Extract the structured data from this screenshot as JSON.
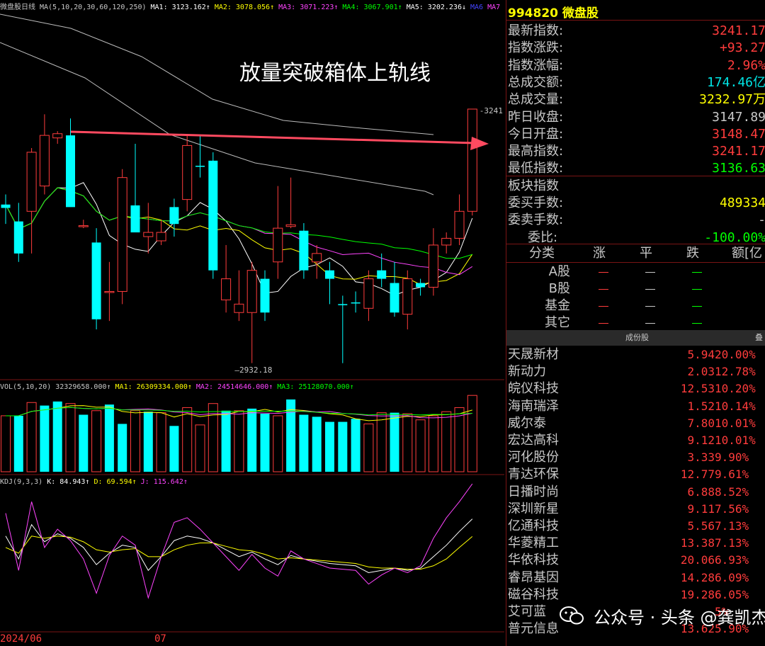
{
  "kline_header": {
    "title": "微盘股日线",
    "params": "MA(5,10,20,30,60,120,250)",
    "ma1": "MA1: 3123.162↑",
    "ma2": "MA2: 3078.056↑",
    "ma3": "MA3: 3071.223↑",
    "ma4": "MA4: 3067.901↑",
    "ma5": "MA5: 3202.236↓",
    "ma6": "MA6",
    "ma7": "MA7",
    "colors": {
      "ma1": "#ffffff",
      "ma2": "#ffff00",
      "ma3": "#ff00ff",
      "ma4": "#00ff00",
      "ma5": "#ffffff"
    }
  },
  "annotation": "放量突破箱体上轨线",
  "price_labels": {
    "high": "3241.17",
    "low": "2932.18"
  },
  "vol_header": {
    "title": "VOL(5,10,20)",
    "value": "32329658.000↑",
    "ma1": "MA1: 26309334.000↑",
    "ma2": "MA2: 24514646.000↑",
    "ma3": "MA3: 25128070.000↑"
  },
  "kdj_header": {
    "title": "KDJ(9,3,3)",
    "k": "K: 84.943↑",
    "d": "D: 69.594↑",
    "j": "J: 115.642↑"
  },
  "dates": {
    "left": "2024/06",
    "mid": "07"
  },
  "chart_data": {
    "type": "candlestick",
    "candles": [
      {
        "o": 3124,
        "h": 3140,
        "l": 3105,
        "c": 3128,
        "up": false
      },
      {
        "o": 3108,
        "h": 3130,
        "l": 3060,
        "c": 3070,
        "up": false
      },
      {
        "o": 3190,
        "h": 3195,
        "l": 3070,
        "c": 3120,
        "up": true
      },
      {
        "o": 3150,
        "h": 3235,
        "l": 3140,
        "c": 3210,
        "up": true
      },
      {
        "o": 3207,
        "h": 3215,
        "l": 3200,
        "c": 3212,
        "up": true
      },
      {
        "o": 3210,
        "h": 3230,
        "l": 3190,
        "c": 3125,
        "up": false
      },
      {
        "o": 3102,
        "h": 3110,
        "l": 3100,
        "c": 3103,
        "up": true
      },
      {
        "o": 3083,
        "h": 3100,
        "l": 2980,
        "c": 2992,
        "up": false
      },
      {
        "o": 3025,
        "h": 3060,
        "l": 2990,
        "c": 3025,
        "up": true
      },
      {
        "o": 3025,
        "h": 3170,
        "l": 3010,
        "c": 3160,
        "up": true
      },
      {
        "o": 3127,
        "h": 3200,
        "l": 3110,
        "c": 3095,
        "up": false
      },
      {
        "o": 3095,
        "h": 3130,
        "l": 3070,
        "c": 3090,
        "up": true
      },
      {
        "o": 3095,
        "h": 3110,
        "l": 3080,
        "c": 3085,
        "up": true
      },
      {
        "o": 3125,
        "h": 3135,
        "l": 3090,
        "c": 3105,
        "up": false
      },
      {
        "o": 3134,
        "h": 3210,
        "l": 3120,
        "c": 3198,
        "up": true
      },
      {
        "o": 3174,
        "h": 3210,
        "l": 3160,
        "c": 3174,
        "up": false
      },
      {
        "o": 3180,
        "h": 3190,
        "l": 3040,
        "c": 3050,
        "up": false
      },
      {
        "o": 3040,
        "h": 3080,
        "l": 3000,
        "c": 3015,
        "up": true
      },
      {
        "o": 3010,
        "h": 3050,
        "l": 2990,
        "c": 3000,
        "up": true
      },
      {
        "o": 3000,
        "h": 3060,
        "l": 2940,
        "c": 3050,
        "up": true
      },
      {
        "o": 3040,
        "h": 3050,
        "l": 2990,
        "c": 3000,
        "up": false
      },
      {
        "o": 3100,
        "h": 3150,
        "l": 3040,
        "c": 3060,
        "up": true
      },
      {
        "o": 3102,
        "h": 3160,
        "l": 3100,
        "c": 3104,
        "up": true
      },
      {
        "o": 3097,
        "h": 3106,
        "l": 3040,
        "c": 3050,
        "up": false
      },
      {
        "o": 3060,
        "h": 3080,
        "l": 3040,
        "c": 3070,
        "up": true
      },
      {
        "o": 3050,
        "h": 3060,
        "l": 3010,
        "c": 3040,
        "up": false
      },
      {
        "o": 3010,
        "h": 3020,
        "l": 2940,
        "c": 3010,
        "up": false
      },
      {
        "o": 3011,
        "h": 3025,
        "l": 3000,
        "c": 3012,
        "up": false
      },
      {
        "o": 3005,
        "h": 3050,
        "l": 2990,
        "c": 3040,
        "up": true
      },
      {
        "o": 3050,
        "h": 3070,
        "l": 3030,
        "c": 3040,
        "up": false
      },
      {
        "o": 3035,
        "h": 3060,
        "l": 2995,
        "c": 3000,
        "up": false
      },
      {
        "o": 2998,
        "h": 3050,
        "l": 2980,
        "c": 3040,
        "up": true
      },
      {
        "o": 3035,
        "h": 3040,
        "l": 3020,
        "c": 3030,
        "up": false
      },
      {
        "o": 3030,
        "h": 3100,
        "l": 3020,
        "c": 3080,
        "up": true
      },
      {
        "o": 3080,
        "h": 3095,
        "l": 3070,
        "c": 3088,
        "up": true
      },
      {
        "o": 3088,
        "h": 3140,
        "l": 3080,
        "c": 3120,
        "up": true
      },
      {
        "o": 3120,
        "h": 3241.17,
        "l": 3115,
        "c": 3241.17,
        "up": true
      }
    ],
    "price_range": [
      2932.18,
      3241.17
    ],
    "volume": [
      0.55,
      0.55,
      0.68,
      0.65,
      0.69,
      0.67,
      0.56,
      0.6,
      0.66,
      0.47,
      0.6,
      0.59,
      0.58,
      0.45,
      0.63,
      0.46,
      0.67,
      0.6,
      0.6,
      0.62,
      0.57,
      0.55,
      0.71,
      0.56,
      0.54,
      0.49,
      0.49,
      0.52,
      0.47,
      0.58,
      0.58,
      0.57,
      0.51,
      0.55,
      0.59,
      0.63,
      0.75
    ],
    "volume_up": [
      true,
      false,
      true,
      false,
      false,
      true,
      false,
      true,
      false,
      false,
      true,
      false,
      true,
      false,
      true,
      true,
      true,
      false,
      true,
      false,
      false,
      true,
      false,
      false,
      false,
      false,
      false,
      false,
      true,
      true,
      false,
      true,
      true,
      true,
      true,
      true,
      true
    ],
    "kdj": {
      "k": [
        70,
        50,
        80,
        65,
        72,
        68,
        60,
        45,
        55,
        62,
        60,
        40,
        52,
        66,
        70,
        68,
        64,
        58,
        52,
        56,
        50,
        45,
        53,
        50,
        48,
        46,
        45,
        44,
        38,
        40,
        42,
        40,
        42,
        52,
        62,
        74,
        84.943
      ],
      "d": [
        60,
        55,
        70,
        68,
        70,
        69,
        65,
        58,
        56,
        58,
        59,
        52,
        52,
        58,
        62,
        64,
        64,
        61,
        58,
        57,
        54,
        50,
        51,
        50,
        49,
        48,
        47,
        46,
        43,
        42,
        42,
        41,
        41,
        44,
        50,
        60,
        69.594
      ],
      "j": [
        90,
        40,
        100,
        60,
        76,
        66,
        50,
        20,
        53,
        70,
        62,
        16,
        52,
        82,
        86,
        76,
        64,
        52,
        40,
        54,
        42,
        35,
        57,
        50,
        46,
        42,
        41,
        40,
        28,
        36,
        42,
        38,
        44,
        68,
        86,
        100,
        115.642
      ]
    }
  },
  "quote": {
    "code": "994820",
    "name": "微盘股",
    "rows": [
      {
        "label": "最新指数:",
        "value": "3241.17",
        "color": "#ff3c3c"
      },
      {
        "label": "指数涨跌:",
        "value": "+93.27",
        "color": "#ff3c3c"
      },
      {
        "label": "指数涨幅:",
        "value": "2.96%",
        "color": "#ff3c3c"
      },
      {
        "label": "总成交额:",
        "value": "174.46亿",
        "color": "#00e5e5"
      },
      {
        "label": "总成交量:",
        "value": "3232.97万",
        "color": "#ffff00"
      },
      {
        "label": "昨日收盘:",
        "value": "3147.89",
        "color": "#c8c8c8"
      },
      {
        "label": "今日开盘:",
        "value": "3148.47",
        "color": "#ff3c3c"
      },
      {
        "label": "最高指数:",
        "value": "3241.17",
        "color": "#ff3c3c"
      },
      {
        "label": "最低指数:",
        "value": "3136.63",
        "color": "#00ff00"
      },
      {
        "label": "板块指数",
        "value": "",
        "color": "#c8c8c8"
      },
      {
        "label": "委买手数:",
        "value": "489334",
        "color": "#ffff00"
      },
      {
        "label": "委卖手数:",
        "value": "-",
        "color": "#c8c8c8"
      },
      {
        "label": "委比:",
        "value": "-100.00%",
        "color": "#00ff00"
      }
    ]
  },
  "category_table": {
    "headers": [
      "分类",
      "涨",
      "平",
      "跌",
      "额[亿"
    ],
    "rows": [
      "A股",
      "B股",
      "基金",
      "其它"
    ]
  },
  "sub_tab": {
    "label": "成份股",
    "right": "叠"
  },
  "stocks": [
    {
      "name": "天晟新材",
      "price": "5.94",
      "pct": "20.00%"
    },
    {
      "name": "新动力",
      "price": "2.03",
      "pct": "12.78%"
    },
    {
      "name": "皖仪科技",
      "price": "12.53",
      "pct": "10.20%"
    },
    {
      "name": "海南瑞泽",
      "price": "1.52",
      "pct": "10.14%"
    },
    {
      "name": "威尔泰",
      "price": "7.80",
      "pct": "10.01%"
    },
    {
      "name": "宏达高科",
      "price": "9.12",
      "pct": "10.01%"
    },
    {
      "name": "河化股份",
      "price": "3.33",
      "pct": "9.90%"
    },
    {
      "name": "青达环保",
      "price": "12.77",
      "pct": "9.61%"
    },
    {
      "name": "日播时尚",
      "price": "6.88",
      "pct": "8.52%"
    },
    {
      "name": "深圳新星",
      "price": "9.11",
      "pct": "7.56%"
    },
    {
      "name": "亿通科技",
      "price": "5.56",
      "pct": "7.13%"
    },
    {
      "name": "华菱精工",
      "price": "13.38",
      "pct": "7.13%"
    },
    {
      "name": "华依科技",
      "price": "20.06",
      "pct": "6.93%"
    },
    {
      "name": "睿昂基因",
      "price": "14.28",
      "pct": "6.09%"
    },
    {
      "name": "磁谷科技",
      "price": "19.28",
      "pct": "6.05%"
    },
    {
      "name": "艾可蓝",
      "price": "",
      "pct": "5%"
    },
    {
      "name": "普元信息",
      "price": "13.62",
      "pct": "5.90%"
    }
  ],
  "watermark": "公众号 · 头条 @龚凯杰"
}
